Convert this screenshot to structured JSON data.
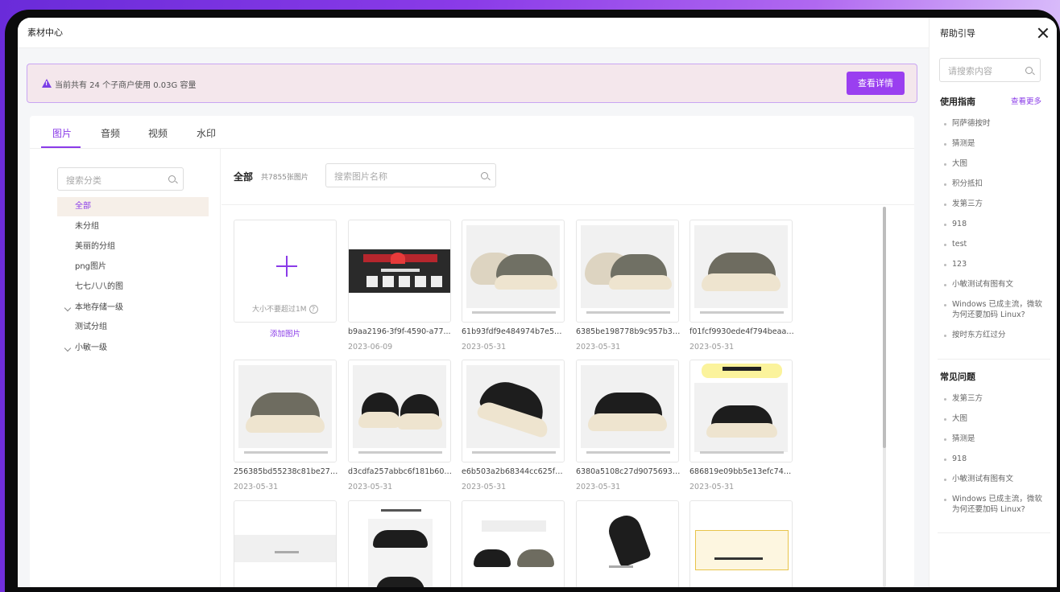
{
  "app": {
    "title": "素材中心"
  },
  "notice": {
    "text": "当前共有 24 个子商户使用 0.03G 容量",
    "button": "查看详情"
  },
  "tabs": [
    {
      "label": "图片",
      "active": true
    },
    {
      "label": "音频"
    },
    {
      "label": "视频"
    },
    {
      "label": "水印"
    }
  ],
  "categories": {
    "search_placeholder": "搜索分类",
    "items": [
      {
        "label": "全部",
        "selected": true
      },
      {
        "label": "未分组"
      },
      {
        "label": "美丽的分组"
      },
      {
        "label": "png图片"
      },
      {
        "label": "七七八八的图"
      },
      {
        "label": "本地存储一级",
        "expandable": true
      },
      {
        "label": "测试分组"
      },
      {
        "label": "小敏一级",
        "expandable": true
      }
    ]
  },
  "images": {
    "header_title": "全部",
    "count": "共7855张图片",
    "search_placeholder": "搜索图片名称",
    "upload": {
      "hint": "大小不要超过1M",
      "add_label": "添加图片"
    },
    "row1": [
      {
        "name": "b9aa2196-3f9f-4590-a77...",
        "date": "2023-06-09"
      },
      {
        "name": "61b93fdf9e484974b7e56b...",
        "date": "2023-05-31"
      },
      {
        "name": "6385be198778b9c957b3b...",
        "date": "2023-05-31"
      },
      {
        "name": "f01fcf9930ede4f794beaa2...",
        "date": "2023-05-31"
      }
    ],
    "row2": [
      {
        "name": "256385bd55238c81be27e...",
        "date": "2023-05-31"
      },
      {
        "name": "d3cdfa257abbc6f181b60b...",
        "date": "2023-05-31"
      },
      {
        "name": "e6b503a2b68344cc625f9...",
        "date": "2023-05-31"
      },
      {
        "name": "6380a5108c27d9075693f...",
        "date": "2023-05-31"
      },
      {
        "name": "686819e09bb5e13efc7436...",
        "date": "2023-05-31"
      }
    ]
  },
  "help": {
    "title": "帮助引导",
    "search_placeholder": "请搜索内容",
    "guide_title": "使用指南",
    "more": "查看更多",
    "guide_items": [
      "阿萨德按时",
      "猜测是",
      "大图",
      "积分抵扣",
      "发第三方",
      "918",
      "test",
      "123",
      "小敏测试有图有文",
      "Windows 已成主流，微软为何还要加码 Linux?",
      "按时东方红过分"
    ],
    "faq_title": "常见问题",
    "faq_items": [
      "发第三方",
      "大图",
      "猜测是",
      "918",
      "小敏测试有图有文",
      "Windows 已成主流，微软为何还要加码 Linux?"
    ]
  },
  "colors": {
    "accent": "#8a3be8",
    "notice_bg": "#f4e7ec"
  }
}
